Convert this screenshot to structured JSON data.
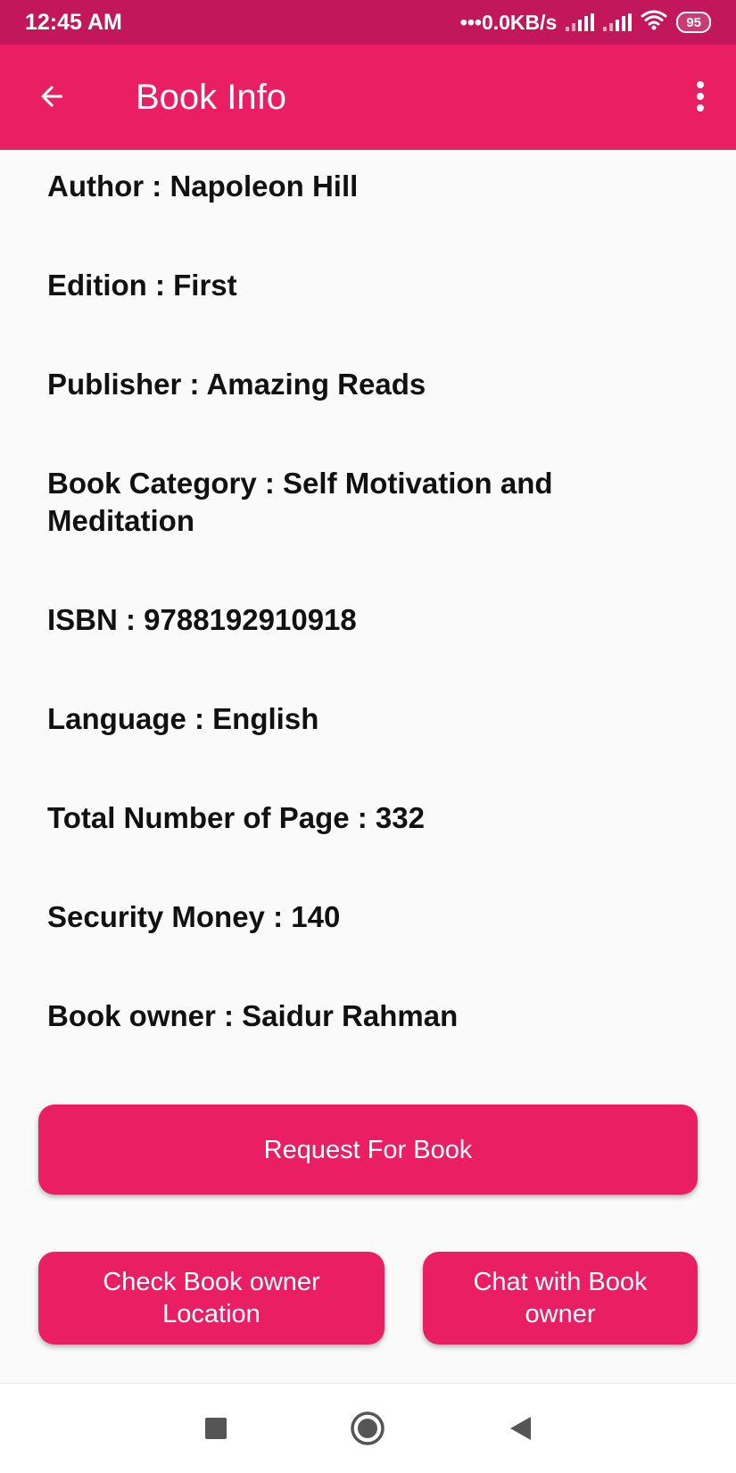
{
  "status_bar": {
    "time": "12:45 AM",
    "network_speed": "•••0.0KB/s",
    "battery_level": "95",
    "icons": [
      "signal-icon",
      "signal-icon",
      "wifi-icon",
      "battery-icon"
    ]
  },
  "app_bar": {
    "title": "Book Info",
    "back_icon": "arrow-back-icon",
    "menu_icon": "more-vert-icon"
  },
  "book_info": {
    "author": "Author : Napoleon Hill",
    "edition": "Edition : First",
    "publisher": "Publisher : Amazing Reads",
    "category": "Book Category : Self Motivation and Meditation",
    "isbn": "ISBN : 9788192910918",
    "language": "Language : English",
    "pages": "Total Number of Page : 332",
    "security_money": "Security Money : 140",
    "owner": "Book owner : Saidur Rahman"
  },
  "actions": {
    "request_label": "Request For Book",
    "location_label": "Check Book owner Location",
    "chat_label": "Chat with Book owner"
  },
  "nav_bar": {
    "icons": [
      "recent-apps-icon",
      "home-icon",
      "back-icon"
    ]
  },
  "colors": {
    "status_bar": "#c2185b",
    "primary": "#e91e63",
    "background": "#fafafa",
    "text": "#111111"
  }
}
